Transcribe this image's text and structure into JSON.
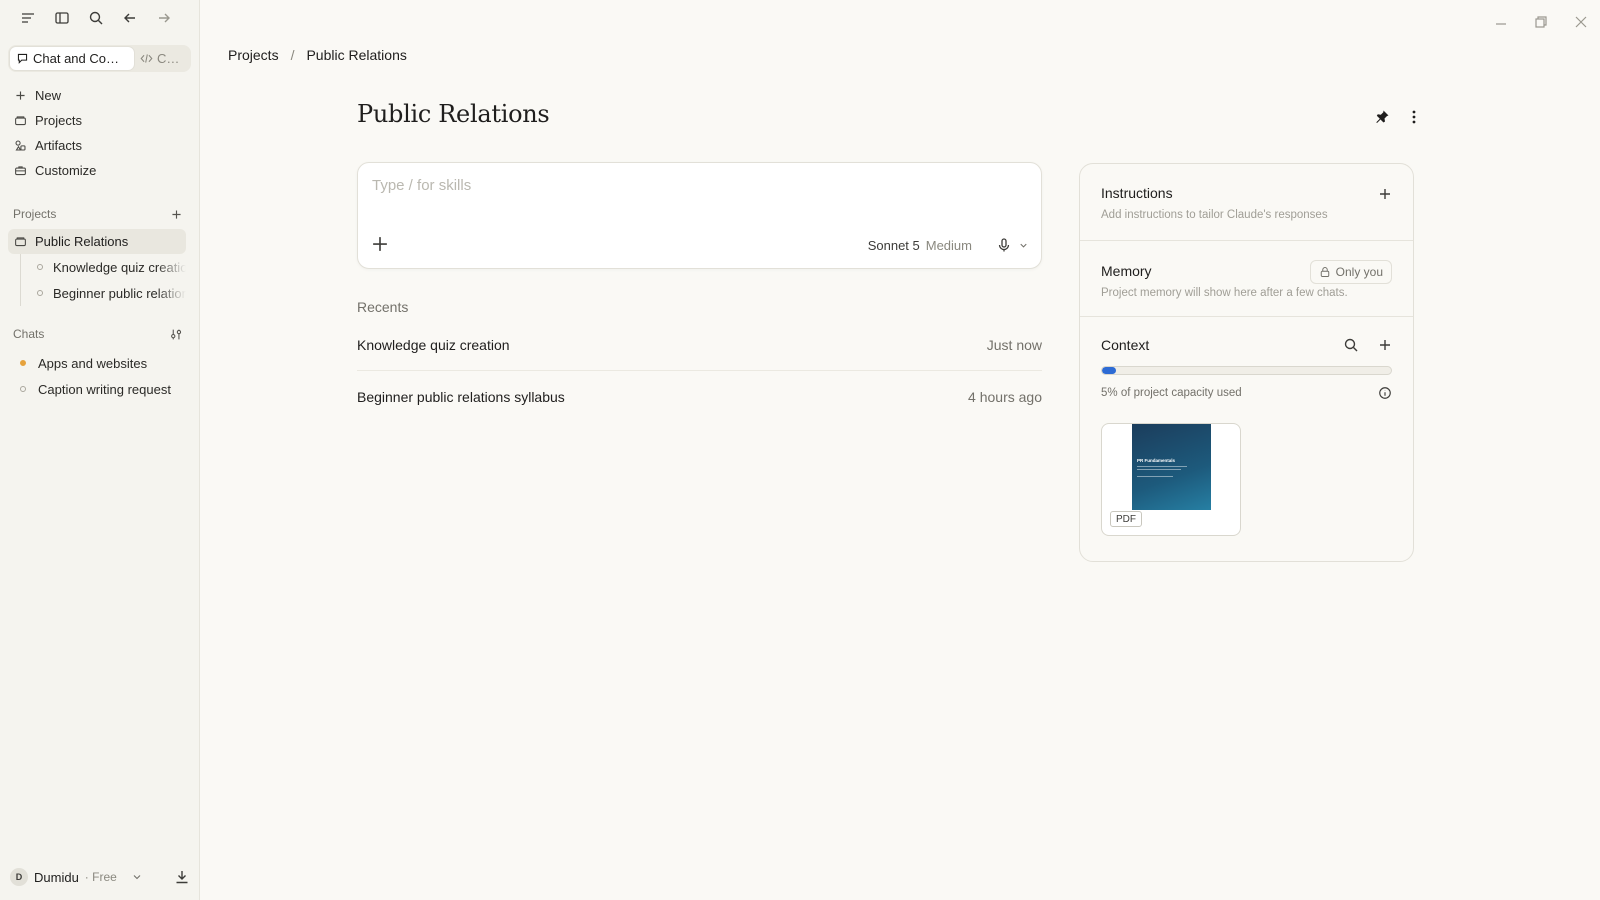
{
  "sidebar": {
    "top_icons": [
      "menu-icon",
      "sidebar-toggle-icon",
      "search-icon",
      "back-arrow-icon",
      "forward-arrow-icon"
    ],
    "mode_tabs": [
      {
        "label": "Chat and Cow…",
        "icon": "chat-bubble-icon",
        "active": true
      },
      {
        "label": "Co…",
        "icon": "code-icon",
        "active": false
      }
    ],
    "nav": [
      {
        "label": "New",
        "icon": "plus-icon"
      },
      {
        "label": "Projects",
        "icon": "folder-icon"
      },
      {
        "label": "Artifacts",
        "icon": "shapes-icon"
      },
      {
        "label": "Customize",
        "icon": "briefcase-icon"
      }
    ],
    "projects_header": "Projects",
    "active_project": "Public Relations",
    "project_chats": [
      "Knowledge quiz creation",
      "Beginner public relations syllabus"
    ],
    "chats_header": "Chats",
    "chats": [
      {
        "label": "Apps and websites",
        "status": "active"
      },
      {
        "label": "Caption writing request",
        "status": "idle"
      }
    ],
    "user": {
      "initial": "D",
      "name": "Dumidu",
      "plan": "· Free"
    }
  },
  "breadcrumb": {
    "root": "Projects",
    "separator": "/",
    "current": "Public Relations"
  },
  "project": {
    "title": "Public Relations"
  },
  "composer": {
    "placeholder": "Type / for skills",
    "value": "",
    "model": "Sonnet 5",
    "effort": "Medium"
  },
  "recents": {
    "label": "Recents",
    "items": [
      {
        "title": "Knowledge quiz creation",
        "time": "Just now"
      },
      {
        "title": "Beginner public relations syllabus",
        "time": "4 hours ago"
      }
    ]
  },
  "panel": {
    "instructions": {
      "title": "Instructions",
      "subtitle": "Add instructions to tailor Claude's responses"
    },
    "memory": {
      "title": "Memory",
      "badge": "Only you",
      "subtitle": "Project memory will show here after a few chats."
    },
    "context": {
      "title": "Context",
      "capacity_fraction": 0.05,
      "capacity_text": "5% of project capacity used",
      "file": {
        "type": "PDF",
        "thumb_title": "PR Fundamentals"
      }
    }
  },
  "colors": {
    "accent": "#2d6bd4",
    "active_dot": "#e6a23c",
    "background": "#faf9f5"
  }
}
